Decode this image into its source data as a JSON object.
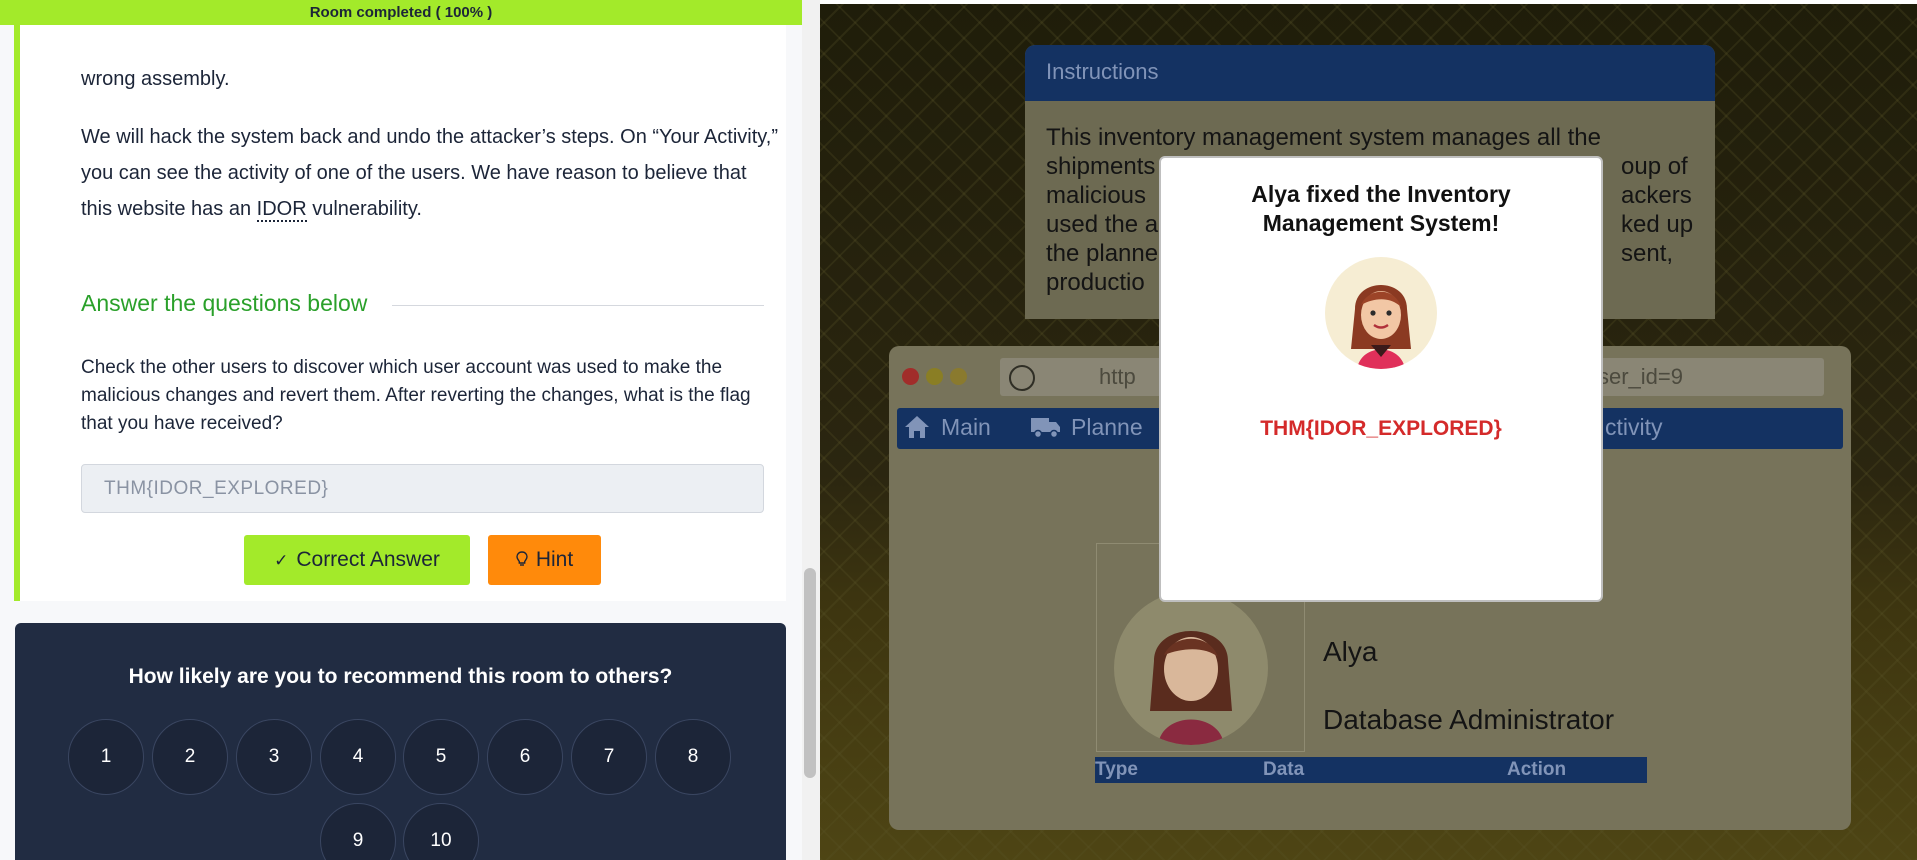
{
  "progress": {
    "label": "Room completed ( 100% )",
    "percent": 100,
    "color": "#a3ea2a"
  },
  "task": {
    "para_top": "wrong assembly.",
    "para_main_1": "We will hack the system back and undo the attacker’s steps. On “Your Activity,” you can see the activity of one of the users. We have reason to believe that this website has an ",
    "idor": "IDOR",
    "para_main_2": " vulnerability.",
    "answer_heading": "Answer the questions below",
    "question": "Check the other users to discover which user account was used to make the malicious changes and revert them. After reverting the changes, what is the flag that you have received?",
    "answer_value": "THM{IDOR_EXPLORED}",
    "correct_button": "Correct Answer",
    "correct_icon": "checkmark-icon",
    "hint_button": "Hint",
    "hint_icon": "lightbulb-icon"
  },
  "survey": {
    "question": "How likely are you to recommend this room to others?",
    "options": [
      "1",
      "2",
      "3",
      "4",
      "5",
      "6",
      "7",
      "8",
      "9",
      "10"
    ]
  },
  "app": {
    "instructions_title": "Instructions",
    "instructions_lines": [
      "This inventory management system manages all the",
      "shipments",
      "malicious",
      "used the a",
      "the planne",
      "productio"
    ],
    "instructions_right": [
      "oup of",
      "ackers",
      "ked up",
      " sent,"
    ],
    "url_left": "http",
    "url_right": "ser_id=9",
    "nav": {
      "main": "Main",
      "planned": "Planne",
      "activity": "ctivity",
      "main_icon": "home-icon",
      "planned_icon": "truck-icon"
    },
    "profile": {
      "name": "Alya",
      "role": "Database Administrator"
    },
    "table_headers": {
      "type": "Type",
      "data": "Data",
      "action": "Action"
    }
  },
  "modal": {
    "title": "Alya fixed the Inventory Management System!",
    "flag": "THM{IDOR_EXPLORED}",
    "avatar": "alya-avatar"
  }
}
